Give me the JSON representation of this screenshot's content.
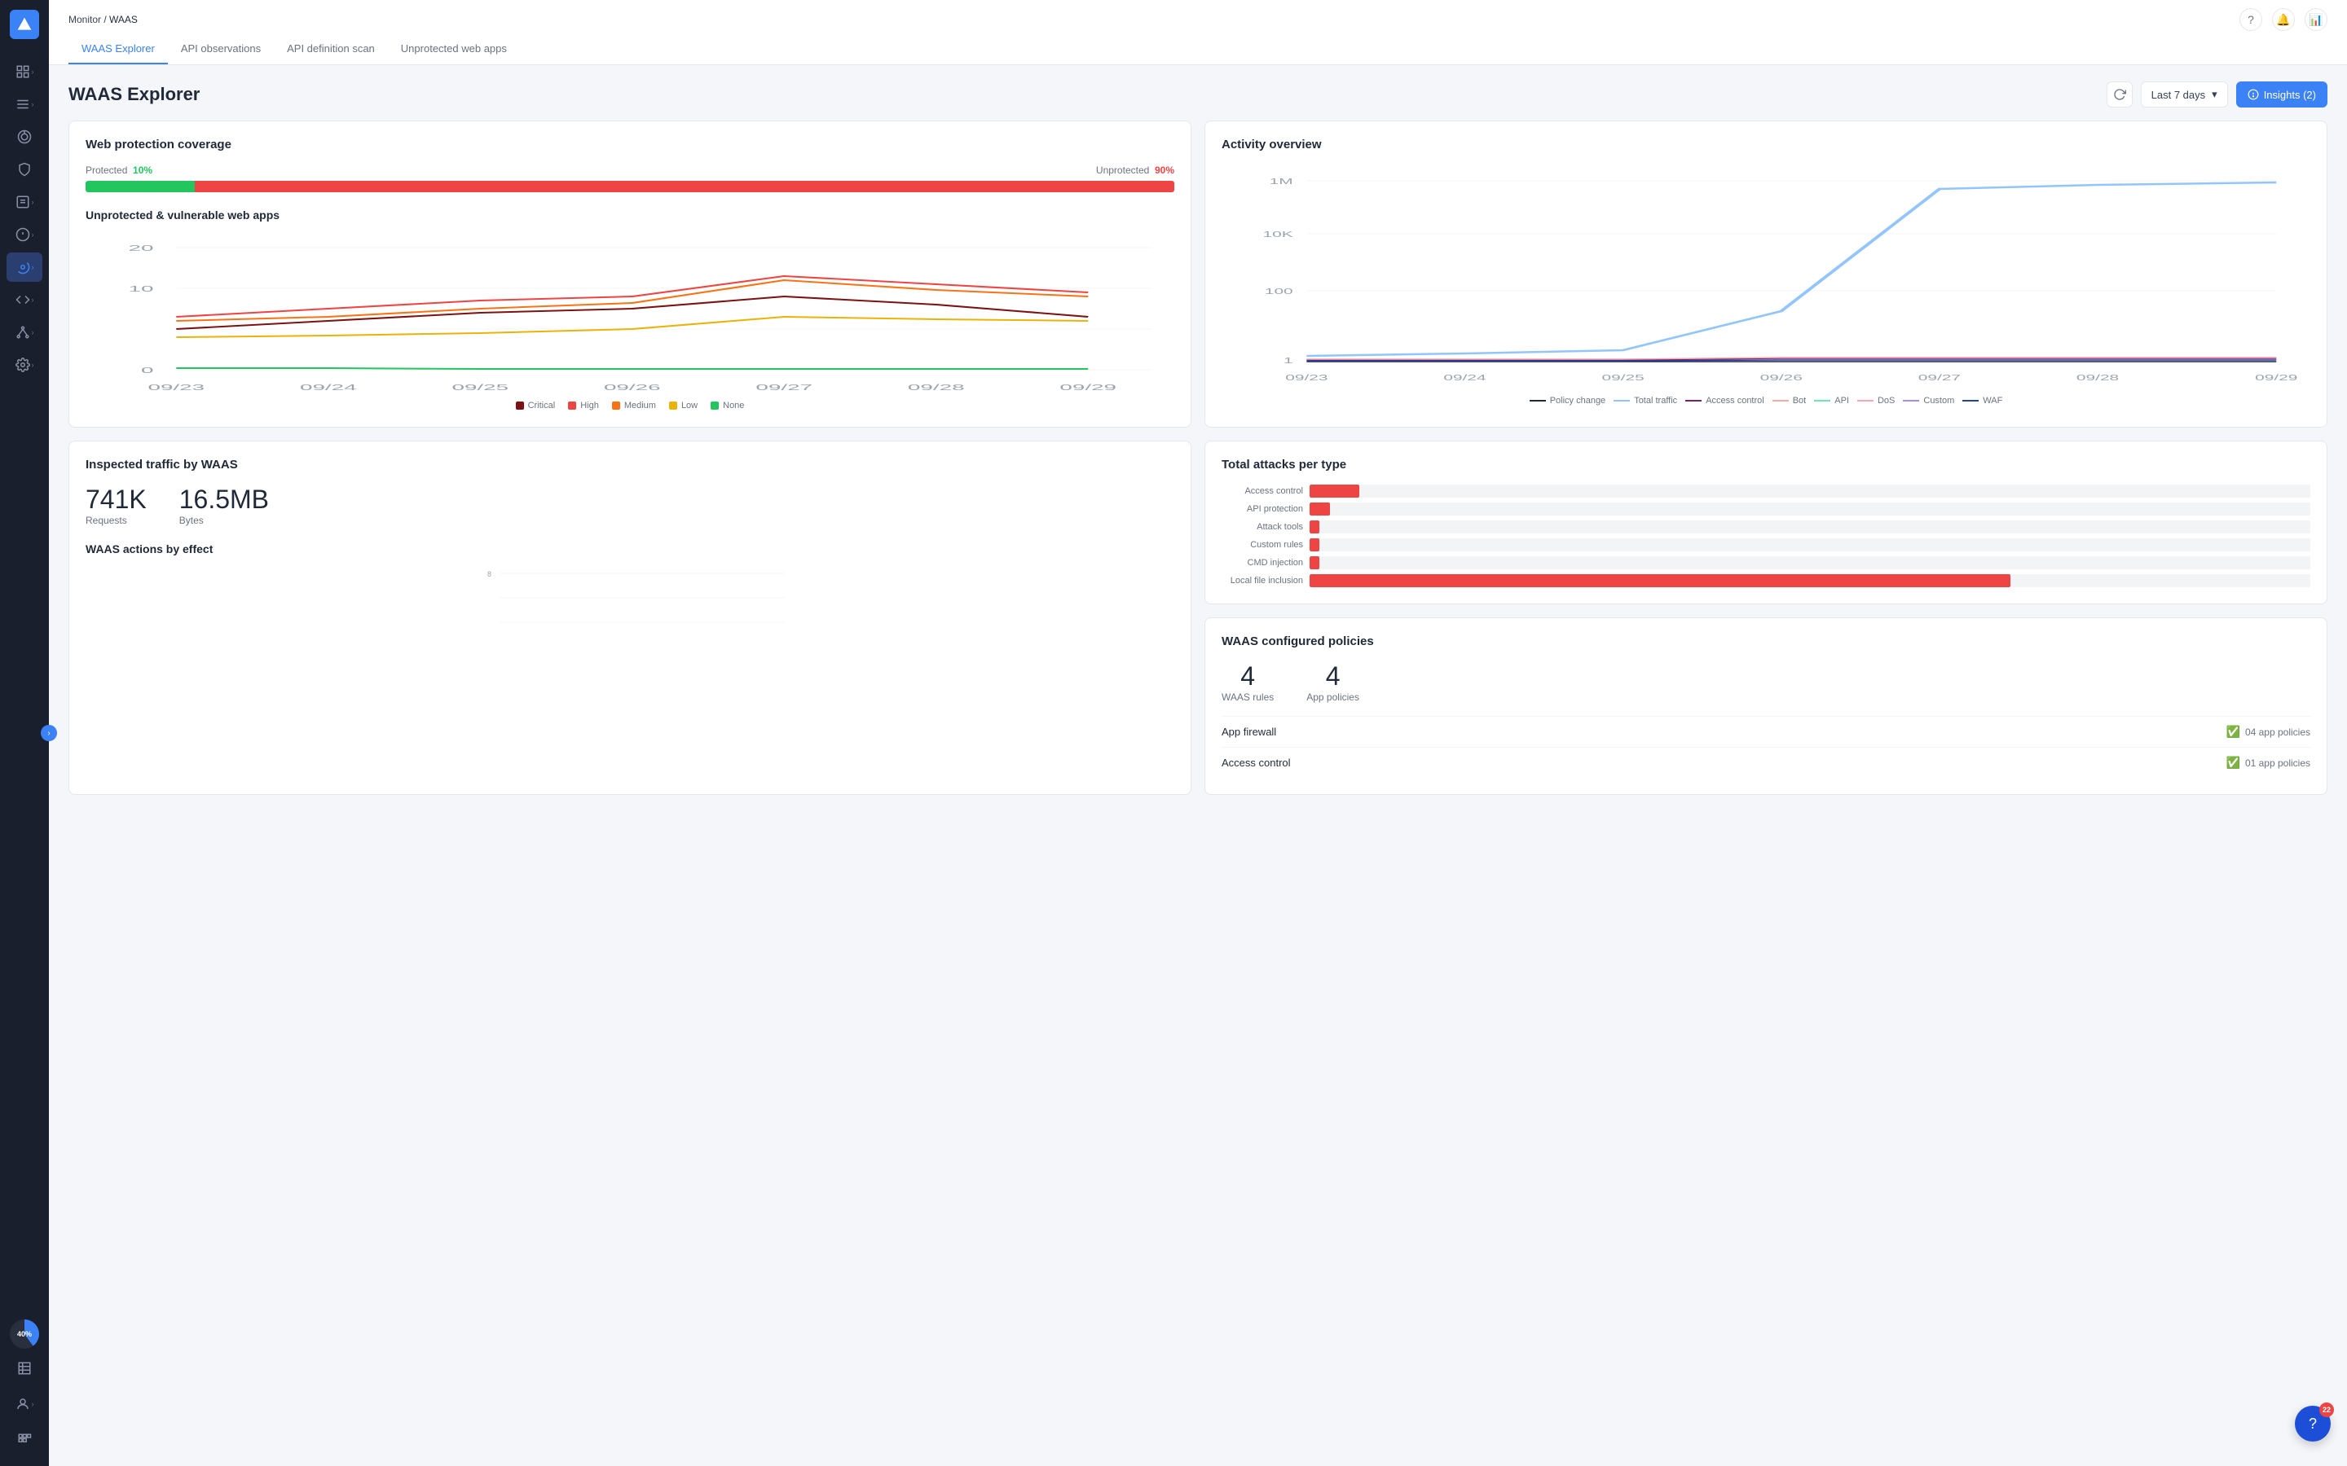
{
  "breadcrumb": {
    "parent": "Monitor",
    "current": "WAAS",
    "separator": "/"
  },
  "tabs": [
    {
      "label": "WAAS Explorer",
      "active": true
    },
    {
      "label": "API observations",
      "active": false
    },
    {
      "label": "API definition scan",
      "active": false
    },
    {
      "label": "Unprotected web apps",
      "active": false
    }
  ],
  "page": {
    "title": "WAAS Explorer",
    "date_selector": "Last 7 days",
    "insights_label": "Insights (2)"
  },
  "coverage": {
    "title": "Web protection coverage",
    "protected_label": "Protected",
    "protected_pct": "10%",
    "unprotected_label": "Unprotected",
    "unprotected_pct": "90%"
  },
  "vulnerable_chart": {
    "title": "Unprotected & vulnerable web apps",
    "legend": [
      {
        "label": "Critical",
        "color": "#7c1212"
      },
      {
        "label": "High",
        "color": "#ef4444"
      },
      {
        "label": "Medium",
        "color": "#f97316"
      },
      {
        "label": "Low",
        "color": "#eab308"
      },
      {
        "label": "None",
        "color": "#22c55e"
      }
    ],
    "x_labels": [
      "09/23",
      "09/24",
      "09/25",
      "09/26",
      "09/27",
      "09/28",
      "09/29"
    ],
    "y_labels": [
      "20",
      "10",
      "0"
    ]
  },
  "activity": {
    "title": "Activity overview",
    "legend": [
      {
        "label": "Policy change",
        "color": "#1f2937",
        "type": "line"
      },
      {
        "label": "Total traffic",
        "color": "#93c5fd",
        "type": "line"
      },
      {
        "label": "Access control",
        "color": "#7c1d6f",
        "type": "line"
      },
      {
        "label": "Bot",
        "color": "#fca5a5",
        "type": "line"
      },
      {
        "label": "API",
        "color": "#6ee7b7",
        "type": "line"
      },
      {
        "label": "DoS",
        "color": "#fca5a5",
        "type": "line"
      },
      {
        "label": "Custom",
        "color": "#a78bfa",
        "type": "line"
      },
      {
        "label": "WAF",
        "color": "#1e40af",
        "type": "line"
      }
    ],
    "y_labels": [
      "1M",
      "10K",
      "100",
      "1"
    ],
    "x_labels": [
      "09/23",
      "09/24",
      "09/25",
      "09/26",
      "09/27",
      "09/28",
      "09/29"
    ]
  },
  "traffic": {
    "title": "Inspected traffic by WAAS",
    "requests_value": "741K",
    "requests_label": "Requests",
    "bytes_value": "16.5MB",
    "bytes_label": "Bytes",
    "actions_title": "WAAS actions by effect",
    "actions_y": "8"
  },
  "attacks": {
    "title": "Total attacks per type",
    "items": [
      {
        "label": "Access control",
        "pct": 2
      },
      {
        "label": "API protection",
        "pct": 1
      },
      {
        "label": "Attack tools",
        "pct": 0
      },
      {
        "label": "Custom rules",
        "pct": 0
      },
      {
        "label": "CMD injection",
        "pct": 0
      },
      {
        "label": "Local file inclusion",
        "pct": 40
      }
    ]
  },
  "policies": {
    "title": "WAAS configured policies",
    "waas_rules_value": "4",
    "waas_rules_label": "WAAS rules",
    "app_policies_value": "4",
    "app_policies_label": "App policies",
    "items": [
      {
        "name": "App firewall",
        "status": "04 app policies"
      },
      {
        "name": "Access control",
        "status": "01 app policies"
      }
    ]
  },
  "help": {
    "badge": "22",
    "label": "?"
  },
  "sidebar": {
    "items": [
      {
        "icon": "grid",
        "active": false
      },
      {
        "icon": "list",
        "active": false,
        "expand": true
      },
      {
        "icon": "search-person",
        "active": false
      },
      {
        "icon": "shield",
        "active": false
      },
      {
        "icon": "list-check",
        "active": false,
        "expand": true
      },
      {
        "icon": "alert",
        "active": false,
        "expand": true
      },
      {
        "icon": "gear-active",
        "active": true,
        "expand": true
      },
      {
        "icon": "code",
        "active": false,
        "expand": true
      },
      {
        "icon": "network",
        "active": false,
        "expand": true
      },
      {
        "icon": "settings",
        "active": false,
        "expand": true
      }
    ]
  }
}
